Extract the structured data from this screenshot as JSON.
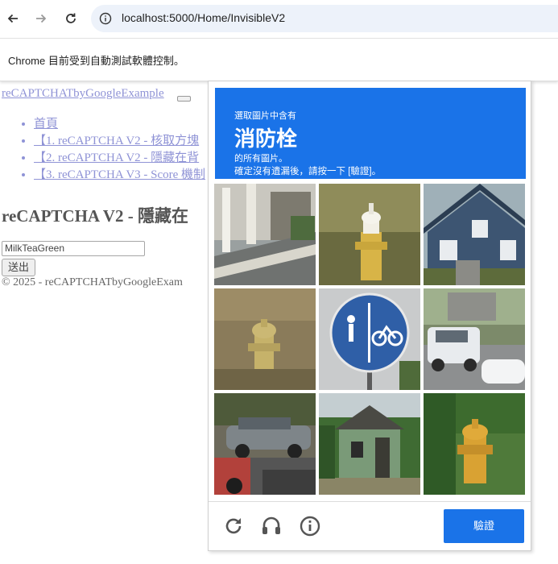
{
  "browser": {
    "url": "localhost:5000/Home/InvisibleV2",
    "infobar_text": "Chrome 目前受到自動測試軟體控制。"
  },
  "page": {
    "brand": "reCAPTCHATbyGoogleExample",
    "nav": [
      "首頁",
      "【1. reCAPTCHA V2 - 核取方塊",
      "【2. reCAPTCHA V2 - 隱藏在背",
      "【3. reCAPTCHA V3 - Score 機制"
    ],
    "heading": "reCAPTCHA V2 - 隱藏在",
    "input_value": "MilkTeaGreen",
    "submit_label": "送出",
    "footer": "© 2025 - reCAPTCHATbyGoogleExam"
  },
  "captcha": {
    "instruction_pre": "選取圖片中含有",
    "target": "消防栓",
    "instruction_post1": "的所有圖片。",
    "instruction_post2": "確定沒有遺漏後，請按一下 [驗證]。",
    "verify_label": "驗證",
    "header_color": "#1a73e8",
    "tiles": [
      {
        "content": "street-sidewalk"
      },
      {
        "content": "white-yellow-hydrant"
      },
      {
        "content": "blue-house"
      },
      {
        "content": "yellow-hydrant-dirt"
      },
      {
        "content": "bicycle-pedestrian-sign"
      },
      {
        "content": "white-suv-street"
      },
      {
        "content": "parked-cars"
      },
      {
        "content": "small-house"
      },
      {
        "content": "yellow-hydrant-grass"
      }
    ],
    "footer_icons": [
      "reload-icon",
      "audio-icon",
      "info-icon"
    ]
  }
}
